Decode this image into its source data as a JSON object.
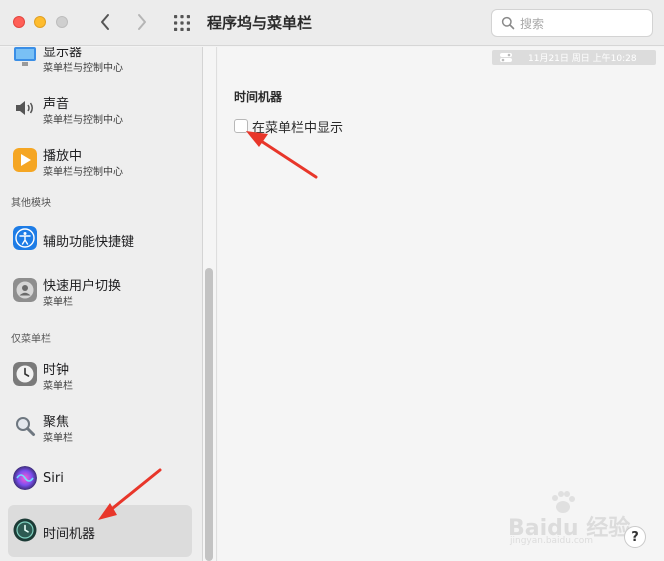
{
  "window": {
    "title": "程序坞与菜单栏",
    "search_placeholder": "搜索",
    "search_value": ""
  },
  "sidebar": {
    "items": [
      {
        "title": "显示器",
        "subtitle": "菜单栏与控制中心",
        "icon": "display-icon"
      },
      {
        "title": "声音",
        "subtitle": "菜单栏与控制中心",
        "icon": "sound-icon"
      },
      {
        "title": "播放中",
        "subtitle": "菜单栏与控制中心",
        "icon": "now-playing-icon"
      }
    ],
    "other_header": "其他模块",
    "other_items": [
      {
        "title": "辅助功能快捷键",
        "subtitle": "",
        "icon": "accessibility-icon"
      },
      {
        "title": "快速用户切换",
        "subtitle": "菜单栏",
        "icon": "user-switch-icon"
      }
    ],
    "menubar_only_header": "仅菜单栏",
    "menubar_only_items": [
      {
        "title": "时钟",
        "subtitle": "菜单栏",
        "icon": "clock-icon"
      },
      {
        "title": "聚焦",
        "subtitle": "菜单栏",
        "icon": "spotlight-icon"
      },
      {
        "title": "Siri",
        "subtitle": "",
        "icon": "siri-icon"
      },
      {
        "title": "时间机器",
        "subtitle": "",
        "icon": "time-machine-icon",
        "selected": true
      }
    ]
  },
  "main": {
    "menubar_preview_time": "11月21日 周日 上午10:28",
    "section_title": "时间机器",
    "show_in_menubar_label": "在菜单栏中显示",
    "show_in_menubar_checked": false
  },
  "help_label": "?",
  "watermark": {
    "brand": "Baidu 经验",
    "url": "jingyan.baidu.com"
  },
  "colors": {
    "accent_arrow": "#e8362a",
    "selected_row": "#dcdcdc",
    "close": "#ff5f57",
    "minimize": "#febc2e"
  }
}
